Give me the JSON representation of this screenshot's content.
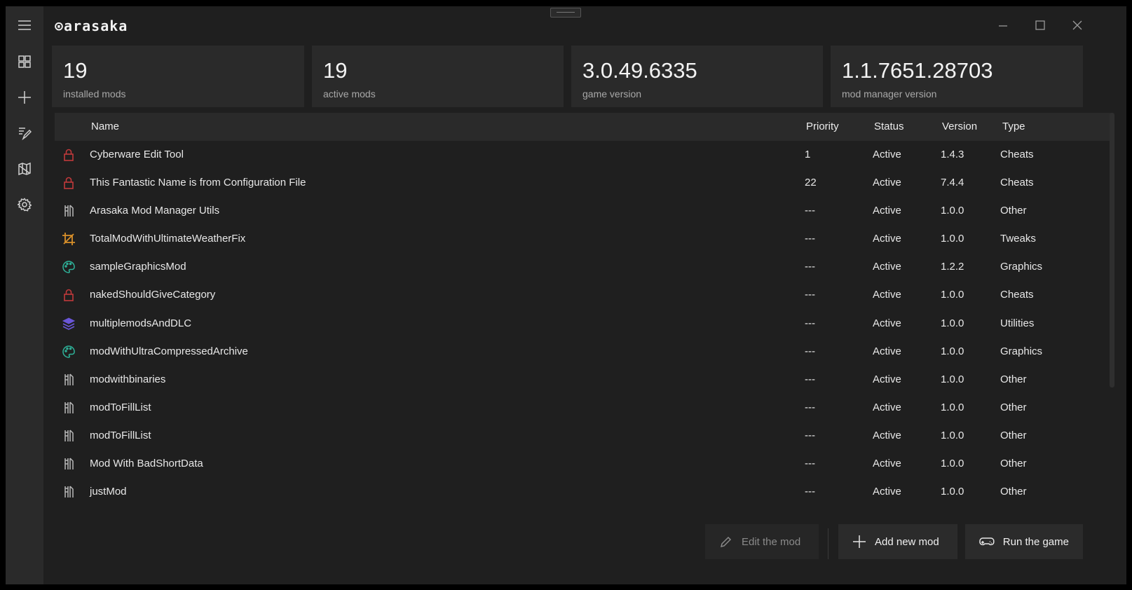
{
  "app": {
    "logo_text": "⊙arasaka"
  },
  "sidebar": {
    "items": [
      {
        "icon": "hamburger-menu-icon"
      },
      {
        "icon": "dashboard-grid-icon"
      },
      {
        "icon": "plus-icon"
      },
      {
        "icon": "edit-list-icon"
      },
      {
        "icon": "map-icon"
      },
      {
        "icon": "gear-icon"
      }
    ]
  },
  "stats": [
    {
      "value": "19",
      "label": "installed mods"
    },
    {
      "value": "19",
      "label": "active mods"
    },
    {
      "value": "3.0.49.6335",
      "label": "game version"
    },
    {
      "value": "1.1.7651.28703",
      "label": "mod manager version"
    }
  ],
  "table": {
    "columns": {
      "name": "Name",
      "priority": "Priority",
      "status": "Status",
      "version": "Version",
      "type": "Type"
    },
    "rows": [
      {
        "icon": "lock",
        "name": "Cyberware Edit Tool",
        "priority": "1",
        "status": "Active",
        "version": "1.4.3",
        "type": "Cheats"
      },
      {
        "icon": "lock",
        "name": "This Fantastic Name is from Configuration File",
        "priority": "22",
        "status": "Active",
        "version": "7.4.4",
        "type": "Cheats"
      },
      {
        "icon": "tools",
        "name": "Arasaka Mod Manager Utils",
        "priority": "---",
        "status": "Active",
        "version": "1.0.0",
        "type": "Other"
      },
      {
        "icon": "crop",
        "name": "TotalModWithUltimateWeatherFix",
        "priority": "---",
        "status": "Active",
        "version": "1.0.0",
        "type": "Tweaks"
      },
      {
        "icon": "palette",
        "name": "sampleGraphicsMod",
        "priority": "---",
        "status": "Active",
        "version": "1.2.2",
        "type": "Graphics"
      },
      {
        "icon": "lock",
        "name": "nakedShouldGiveCategory",
        "priority": "---",
        "status": "Active",
        "version": "1.0.0",
        "type": "Cheats"
      },
      {
        "icon": "layers",
        "name": "multiplemodsAndDLC",
        "priority": "---",
        "status": "Active",
        "version": "1.0.0",
        "type": "Utilities"
      },
      {
        "icon": "palette",
        "name": "modWithUltraCompressedArchive",
        "priority": "---",
        "status": "Active",
        "version": "1.0.0",
        "type": "Graphics"
      },
      {
        "icon": "tools",
        "name": "modwithbinaries",
        "priority": "---",
        "status": "Active",
        "version": "1.0.0",
        "type": "Other"
      },
      {
        "icon": "tools",
        "name": "modToFillList",
        "priority": "---",
        "status": "Active",
        "version": "1.0.0",
        "type": "Other"
      },
      {
        "icon": "tools",
        "name": "modToFillList",
        "priority": "---",
        "status": "Active",
        "version": "1.0.0",
        "type": "Other"
      },
      {
        "icon": "tools",
        "name": "Mod With BadShortData",
        "priority": "---",
        "status": "Active",
        "version": "1.0.0",
        "type": "Other"
      },
      {
        "icon": "tools",
        "name": "justMod",
        "priority": "---",
        "status": "Active",
        "version": "1.0.0",
        "type": "Other"
      }
    ]
  },
  "footer": {
    "edit_label": "Edit the mod",
    "add_label": "Add new mod",
    "run_label": "Run the game"
  },
  "colors": {
    "lock": "#c0393b",
    "tools": "#b9b9b9",
    "crop": "#d9902a",
    "palette": "#2eb39a",
    "layers": "#6a56d8"
  }
}
